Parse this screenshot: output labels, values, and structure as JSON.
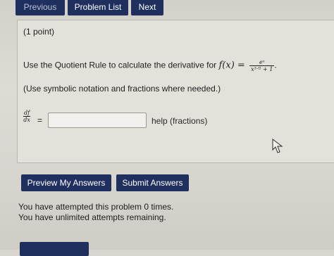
{
  "nav": {
    "previous_label": "Previous",
    "problem_list_label": "Problem List",
    "next_label": "Next"
  },
  "problem": {
    "points": "(1 point)",
    "statement_prefix": "Use the Quotient Rule to calculate the derivative for",
    "function_lhs": "f(x) =",
    "function_numerator": "eˣ",
    "function_denominator": "x⁵ᐟ² + 1",
    "statement_suffix": ".",
    "notation_hint": "(Use symbolic notation and fractions where needed.)",
    "derivative_numerator": "df",
    "derivative_denominator": "dx",
    "equals": "=",
    "answer_value": "",
    "help_label": "help (fractions)"
  },
  "actions": {
    "preview_label": "Preview My Answers",
    "submit_label": "Submit Answers"
  },
  "status": {
    "attempted": "You have attempted this problem 0 times.",
    "remaining": "You have unlimited attempts remaining."
  },
  "colors": {
    "button_bg": "#1f2f5e",
    "button_text": "#ffffff"
  }
}
